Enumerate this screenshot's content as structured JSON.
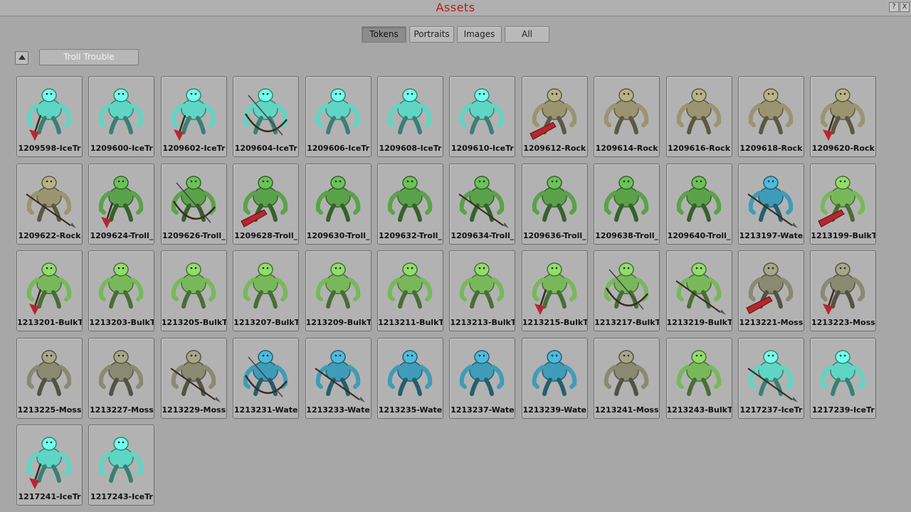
{
  "window": {
    "title": "Assets",
    "help_label": "?",
    "close_label": "X"
  },
  "tabs": [
    {
      "label": "Tokens",
      "active": true
    },
    {
      "label": "Portraits",
      "active": false
    },
    {
      "label": "Images",
      "active": false
    },
    {
      "label": "All",
      "active": false
    }
  ],
  "group": {
    "label": "Troll Trouble",
    "collapse_icon": "triangle-up-icon"
  },
  "palette": {
    "ice": "#5fd6c4",
    "rock": "#9a9470",
    "troll": "#5aa24a",
    "bulk": "#78b85a",
    "moss": "#8a8a72",
    "water": "#3f9cb8",
    "weapon_red": "#b8262e",
    "weapon_dark": "#3a2a20"
  },
  "tokens": [
    {
      "label": "1209598-IceTr",
      "kind": "ice",
      "weapon": "axe"
    },
    {
      "label": "1209600-IceTr",
      "kind": "ice",
      "weapon": "none"
    },
    {
      "label": "1209602-IceTr",
      "kind": "ice",
      "weapon": "axe"
    },
    {
      "label": "1209604-IceTr",
      "kind": "ice",
      "weapon": "bow"
    },
    {
      "label": "1209606-IceTr",
      "kind": "ice",
      "weapon": "none"
    },
    {
      "label": "1209608-IceTr",
      "kind": "ice",
      "weapon": "none"
    },
    {
      "label": "1209610-IceTr",
      "kind": "ice",
      "weapon": "none"
    },
    {
      "label": "1209612-Rock",
      "kind": "rock",
      "weapon": "club"
    },
    {
      "label": "1209614-Rock",
      "kind": "rock",
      "weapon": "none"
    },
    {
      "label": "1209616-Rock",
      "kind": "rock",
      "weapon": "none"
    },
    {
      "label": "1209618-Rock",
      "kind": "rock",
      "weapon": "none"
    },
    {
      "label": "1209620-Rock",
      "kind": "rock",
      "weapon": "axe"
    },
    {
      "label": "1209622-Rock",
      "kind": "rock",
      "weapon": "spear"
    },
    {
      "label": "1209624-Troll_",
      "kind": "troll",
      "weapon": "axe"
    },
    {
      "label": "1209626-Troll_",
      "kind": "troll",
      "weapon": "bow"
    },
    {
      "label": "1209628-Troll_",
      "kind": "troll",
      "weapon": "club"
    },
    {
      "label": "1209630-Troll_",
      "kind": "troll",
      "weapon": "none"
    },
    {
      "label": "1209632-Troll_",
      "kind": "troll",
      "weapon": "none"
    },
    {
      "label": "1209634-Troll_",
      "kind": "troll",
      "weapon": "spear"
    },
    {
      "label": "1209636-Troll_",
      "kind": "troll",
      "weapon": "none"
    },
    {
      "label": "1209638-Troll_",
      "kind": "troll",
      "weapon": "none"
    },
    {
      "label": "1209640-Troll_",
      "kind": "troll",
      "weapon": "none"
    },
    {
      "label": "1213197-Wate",
      "kind": "water",
      "weapon": "spear"
    },
    {
      "label": "1213199-BulkT",
      "kind": "bulk",
      "weapon": "club"
    },
    {
      "label": "1213201-BulkT",
      "kind": "bulk",
      "weapon": "axe"
    },
    {
      "label": "1213203-BulkT",
      "kind": "bulk",
      "weapon": "none"
    },
    {
      "label": "1213205-BulkT",
      "kind": "bulk",
      "weapon": "none"
    },
    {
      "label": "1213207-BulkT",
      "kind": "bulk",
      "weapon": "none"
    },
    {
      "label": "1213209-BulkT",
      "kind": "bulk",
      "weapon": "none"
    },
    {
      "label": "1213211-BulkT",
      "kind": "bulk",
      "weapon": "none"
    },
    {
      "label": "1213213-BulkT",
      "kind": "bulk",
      "weapon": "none"
    },
    {
      "label": "1213215-BulkT",
      "kind": "bulk",
      "weapon": "axe"
    },
    {
      "label": "1213217-BulkT",
      "kind": "bulk",
      "weapon": "bow"
    },
    {
      "label": "1213219-BulkT",
      "kind": "bulk",
      "weapon": "spear"
    },
    {
      "label": "1213221-Moss",
      "kind": "moss",
      "weapon": "club"
    },
    {
      "label": "1213223-Moss",
      "kind": "moss",
      "weapon": "axe"
    },
    {
      "label": "1213225-Moss",
      "kind": "moss",
      "weapon": "none"
    },
    {
      "label": "1213227-Moss",
      "kind": "moss",
      "weapon": "none"
    },
    {
      "label": "1213229-Moss",
      "kind": "moss",
      "weapon": "spear"
    },
    {
      "label": "1213231-Wate",
      "kind": "water",
      "weapon": "bow"
    },
    {
      "label": "1213233-Wate",
      "kind": "water",
      "weapon": "spear"
    },
    {
      "label": "1213235-Wate",
      "kind": "water",
      "weapon": "none"
    },
    {
      "label": "1213237-Wate",
      "kind": "water",
      "weapon": "none"
    },
    {
      "label": "1213239-Wate",
      "kind": "water",
      "weapon": "none"
    },
    {
      "label": "1213241-Moss",
      "kind": "moss",
      "weapon": "none"
    },
    {
      "label": "1213243-BulkT",
      "kind": "bulk",
      "weapon": "none"
    },
    {
      "label": "1217237-IceTr",
      "kind": "ice",
      "weapon": "spear"
    },
    {
      "label": "1217239-IceTr",
      "kind": "ice",
      "weapon": "none"
    },
    {
      "label": "1217241-IceTr",
      "kind": "ice",
      "weapon": "axe"
    },
    {
      "label": "1217243-IceTr",
      "kind": "ice",
      "weapon": "none"
    }
  ]
}
